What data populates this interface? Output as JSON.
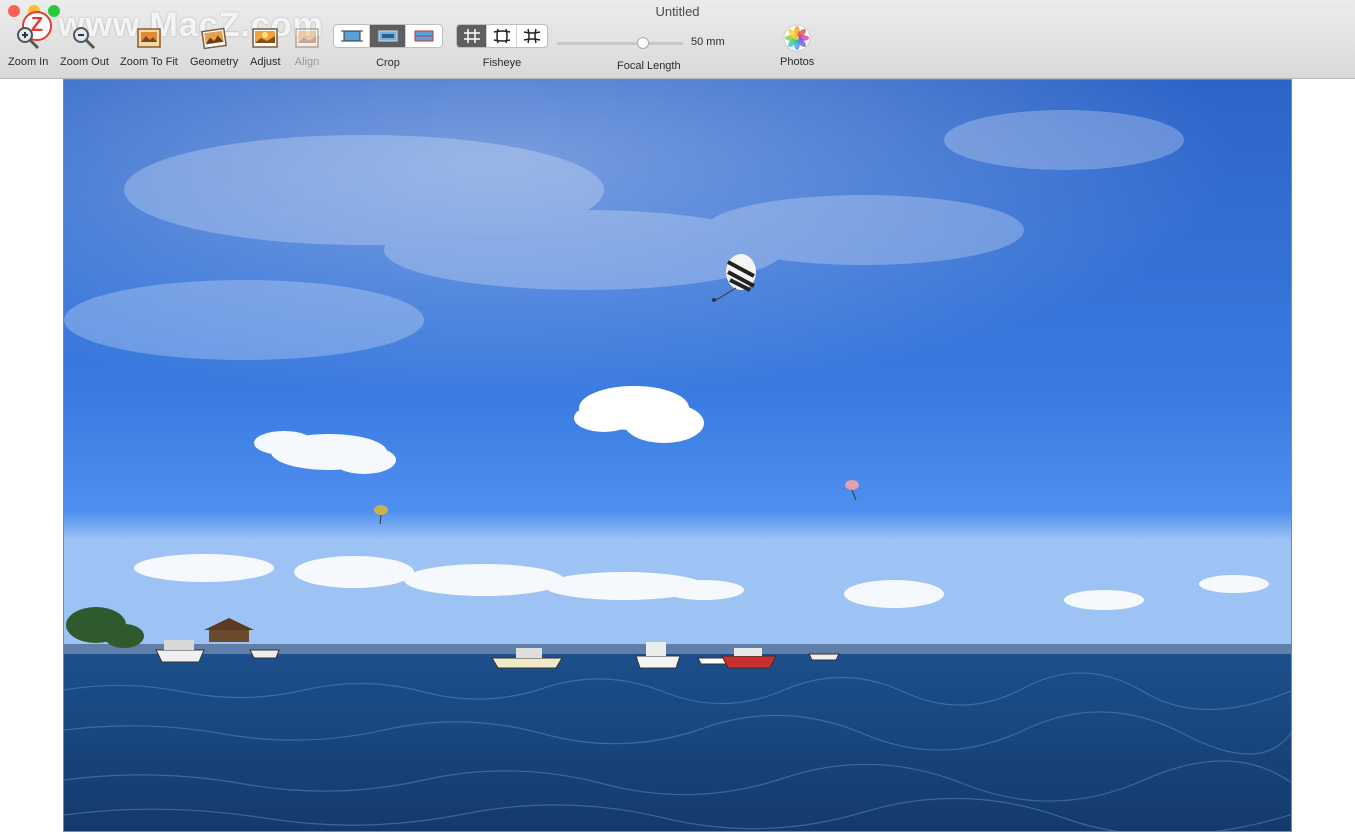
{
  "window": {
    "title": "Untitled"
  },
  "watermark": {
    "text": "www.MacZ.com",
    "logo_letter": "Z"
  },
  "toolbar": {
    "zoom_in": "Zoom In",
    "zoom_out": "Zoom Out",
    "zoom_to_fit": "Zoom To Fit",
    "geometry": "Geometry",
    "adjust": "Adjust",
    "align": "Align",
    "crop": "Crop",
    "fisheye": "Fisheye",
    "focal_length": "Focal Length",
    "focal_value": "50 mm",
    "focal_level": 0.7,
    "photos": "Photos",
    "crop_selected_index": 1,
    "fisheye_selected_index": 0
  },
  "colors": {
    "sky_top": "#2f6fd9",
    "sky_bottom": "#4a86e6",
    "sea": "#1f4d8a",
    "toolbar_bg": "#e3e3e3"
  },
  "icons": [
    "zoom-in-icon",
    "zoom-out-icon",
    "zoom-to-fit-icon",
    "geometry-icon",
    "adjust-icon",
    "align-icon",
    "crop-icon",
    "fisheye-icon",
    "photos-icon"
  ]
}
